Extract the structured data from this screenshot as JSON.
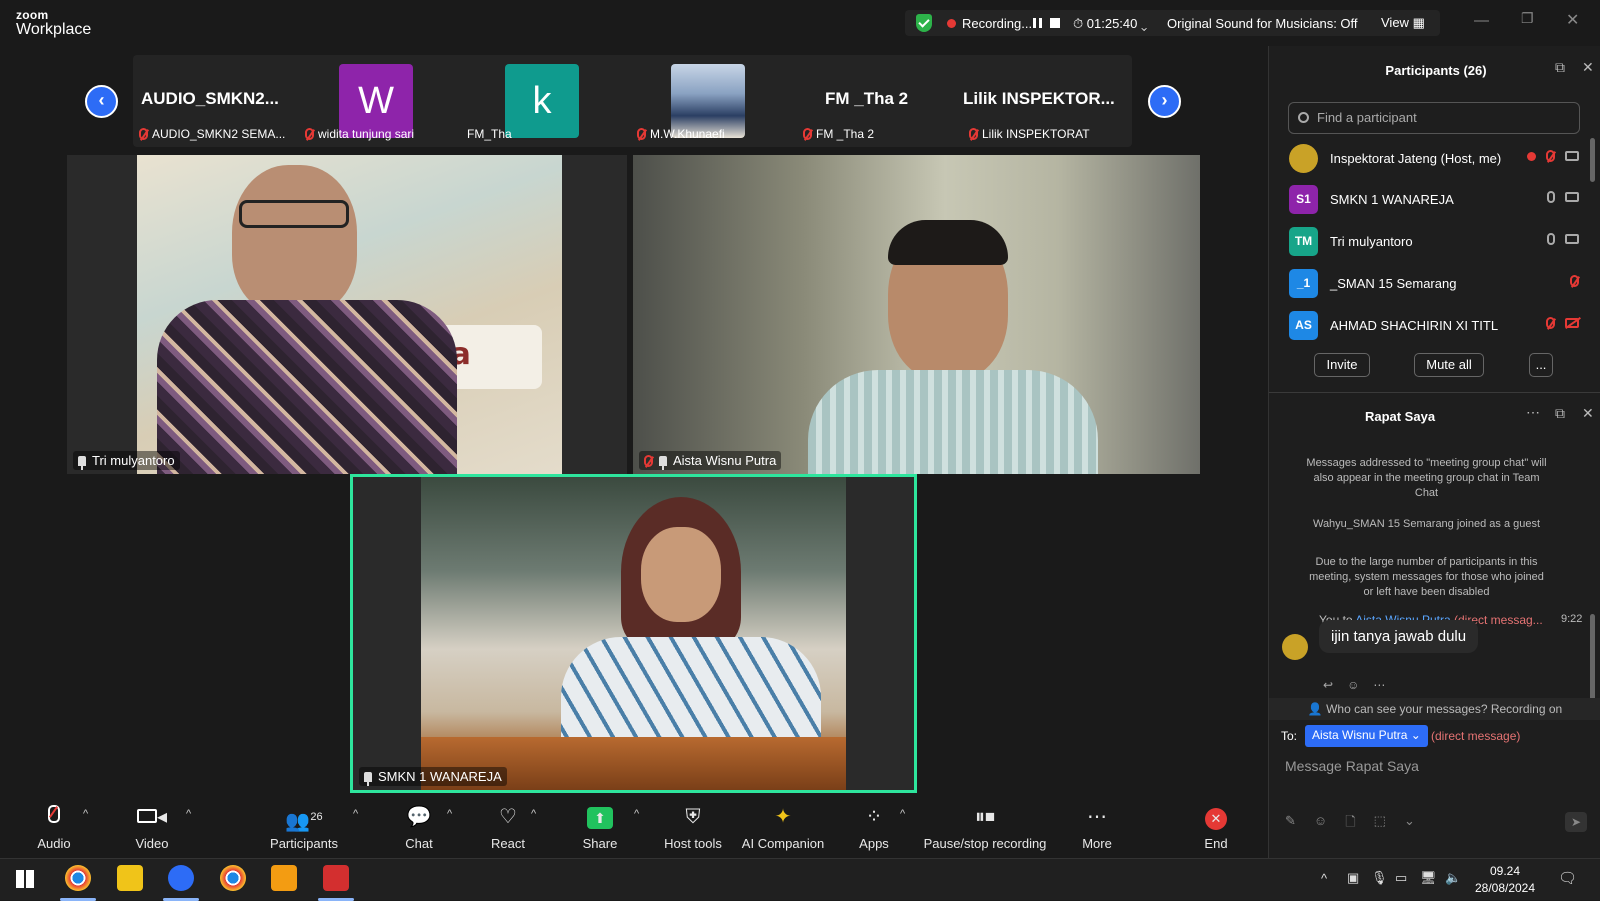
{
  "app": {
    "logo_top": "zoom",
    "logo_bottom": "Workplace"
  },
  "recording": {
    "status": "Recording...",
    "elapsed": "01:25:40",
    "original_sound": "Original Sound for Musicians: Off",
    "view_label": "View"
  },
  "thumbnails": [
    {
      "display": "AUDIO_SMKN2...",
      "label": "AUDIO_SMKN2 SEMA...",
      "muted": true
    },
    {
      "display": "W",
      "label": "widita tunjung sari",
      "muted": true,
      "avatar_color": "#8e24aa"
    },
    {
      "display": "k",
      "label": "FM_Tha",
      "muted": false,
      "avatar_color": "#0f9b8e"
    },
    {
      "display": "",
      "label": "M.W.Khunaefi",
      "muted": true
    },
    {
      "display": "FM _Tha 2",
      "label": "FM _Tha 2",
      "muted": true
    },
    {
      "display": "Lilik  INSPEKTOR...",
      "label": "Lilik INSPEKTORAT",
      "muted": true
    }
  ],
  "videos": {
    "tile1": {
      "name": "Tri mulyantoro"
    },
    "tile2": {
      "name": "Aista Wisnu Putra"
    },
    "tile3": {
      "name": "SMKN 1 WANAREJA"
    },
    "wall_text": "i Rakya"
  },
  "toolbar": {
    "audio": "Audio",
    "video": "Video",
    "participants": "Participants",
    "participants_count": "26",
    "chat": "Chat",
    "react": "React",
    "share": "Share",
    "host_tools": "Host tools",
    "ai_companion": "AI Companion",
    "apps": "Apps",
    "pause_stop": "Pause/stop recording",
    "more": "More",
    "end": "End"
  },
  "participants_panel": {
    "title": "Participants (26)",
    "search_placeholder": "Find a participant",
    "list": [
      {
        "initials": "",
        "name": "Inspektorat Jateng (Host, me)",
        "color": "#c9a227"
      },
      {
        "initials": "S1",
        "name": "SMKN 1 WANAREJA",
        "color": "#8e24aa"
      },
      {
        "initials": "TM",
        "name": "Tri mulyantoro",
        "color": "#17a589"
      },
      {
        "initials": "_1",
        "name": "_SMAN 15 Semarang",
        "color": "#1e88e5"
      },
      {
        "initials": "AS",
        "name": "AHMAD SHACHIRIN XI TITL",
        "color": "#1e88e5"
      }
    ],
    "invite": "Invite",
    "mute_all": "Mute all",
    "more": "..."
  },
  "chat_panel": {
    "title": "Rapat Saya",
    "sys1": "Messages addressed to \"meeting group chat\" will also appear in the meeting group chat in Team Chat",
    "sys2": "Wahyu_SMAN 15 Semarang joined as a guest",
    "sys3": "Due to the large number of participants in this meeting, system messages for those who joined or left have been disabled",
    "msg_from": "You to",
    "msg_to": "Aista Wisnu Putra",
    "msg_tag": "(direct messag...",
    "msg_time": "9:22",
    "msg_text": "ijin tanya jawab dulu",
    "visibility": "Who can see your messages? Recording on",
    "to_label": "To:",
    "recipient": "Aista Wisnu Putra",
    "direct_tag": "(direct message)",
    "input_placeholder": "Message Rapat Saya"
  },
  "taskbar": {
    "time": "09.24",
    "date": "28/08/2024"
  }
}
